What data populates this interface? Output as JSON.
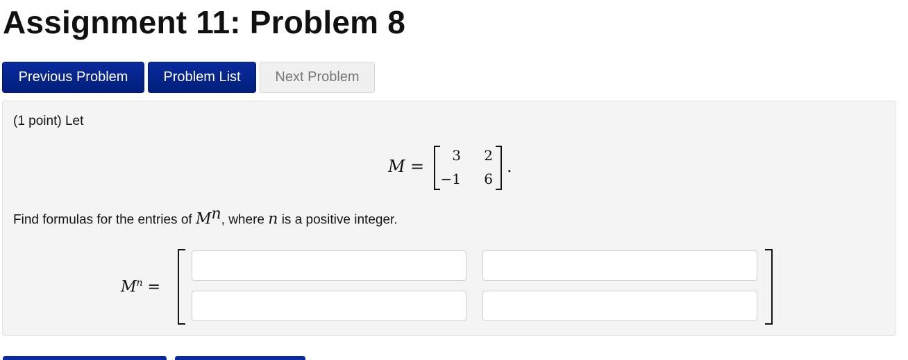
{
  "page": {
    "title": "Assignment 11: Problem 8"
  },
  "nav": {
    "previous": "Previous Problem",
    "list": "Problem List",
    "next": "Next Problem"
  },
  "problem": {
    "intro": "(1 point) Let",
    "matrix_symbol": "M",
    "equals": "=",
    "matrix": [
      [
        "3",
        "2"
      ],
      [
        "−1",
        "6"
      ]
    ],
    "period": ".",
    "find_prefix": "Find formulas for the entries of ",
    "find_mn_base": "M",
    "find_mn_exp": "n",
    "find_middle": ", where ",
    "find_n": "n",
    "find_suffix": " is a positive integer.",
    "answer_label_base": "M",
    "answer_label_exp": "n",
    "answer_label_eq": "=",
    "answers": [
      [
        "",
        ""
      ],
      [
        "",
        ""
      ]
    ]
  },
  "colors": {
    "primary_button": "#0a2a9e",
    "panel_bg": "#f4f4f4"
  }
}
